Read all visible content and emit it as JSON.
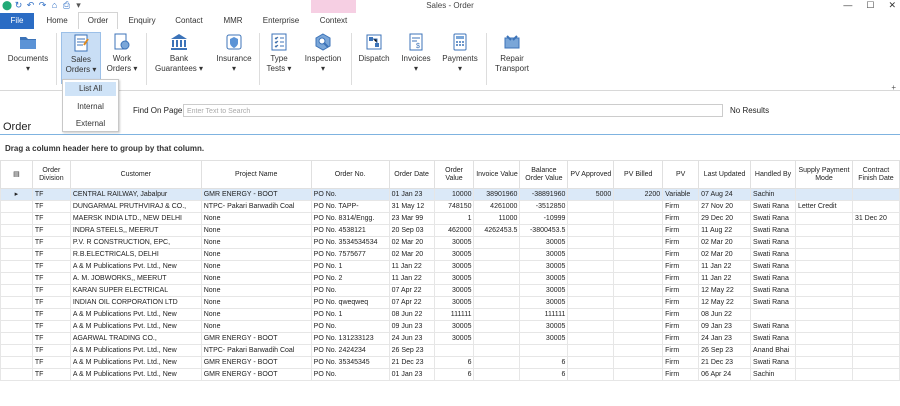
{
  "window": {
    "title": "Sales - Order"
  },
  "tabs": [
    {
      "label": "File"
    },
    {
      "label": "Home"
    },
    {
      "label": "Order"
    },
    {
      "label": "Enquiry"
    },
    {
      "label": "Contact"
    },
    {
      "label": "MMR"
    },
    {
      "label": "Enterprise"
    },
    {
      "label": "Context"
    }
  ],
  "ribbon": {
    "documents": "Documents",
    "sales_orders_1": "Sales",
    "sales_orders_2": "Orders ▾",
    "work_orders_1": "Work",
    "work_orders_2": "Orders ▾",
    "bank_1": "Bank",
    "bank_2": "Guarantees ▾",
    "insurance_1": "Insurance",
    "insurance_2": "▾",
    "type_tests_1": "Type",
    "type_tests_2": "Tests ▾",
    "inspection_1": "Inspection",
    "inspection_2": "▾",
    "dispatch": "Dispatch",
    "invoices_1": "Invoices",
    "invoices_2": "▾",
    "payments_1": "Payments",
    "payments_2": "▾",
    "repair_1": "Repair",
    "repair_2": "Transport"
  },
  "dropdown": {
    "items": [
      "List All",
      "Internal",
      "External"
    ]
  },
  "find": {
    "label": "Find On Page",
    "placeholder": "Enter Text to Search",
    "result": "No Results"
  },
  "section_title": "Order",
  "group_hint": "Drag a column header here to group by that column.",
  "grid": {
    "headers": [
      "Order Division",
      "Customer",
      "Project Name",
      "Order No.",
      "Order Date",
      "Order Value",
      "Invoice Value",
      "Balance Order Value",
      "PV Approved",
      "PV Billed",
      "PV",
      "Last Updated",
      "Handled By",
      "Supply Payment Mode",
      "Contract Finish Date"
    ],
    "rows": [
      [
        "TF",
        "CENTRAL RAILWAY, Jabalpur",
        "GMR ENERGY - BOOT",
        "PO No.",
        "01 Jan 23",
        "10000",
        "38901960",
        "-38891960",
        "5000",
        "2200",
        "Variable",
        "07 Aug 24",
        "Sachin",
        "",
        ""
      ],
      [
        "TF",
        "DUNGARMAL PRUTHVIRAJ & CO.,",
        "NTPC- Pakari Barwadih Coal",
        "PO No. TAPP-",
        "31 May 12",
        "748150",
        "4261000",
        "-3512850",
        "",
        "",
        "Firm",
        "27 Nov 20",
        "Swati Rana",
        "Letter Credit",
        ""
      ],
      [
        "TF",
        "MAERSK INDIA LTD., NEW DELHI",
        "None",
        "PO No. 8314/Engg.",
        "23 Mar 99",
        "1",
        "11000",
        "-10999",
        "",
        "",
        "Firm",
        "29 Dec 20",
        "Swati Rana",
        "",
        "31 Dec 20"
      ],
      [
        "TF",
        "INDRA STEELS,, MEERUT",
        "None",
        "PO No. 4538121",
        "20 Sep 03",
        "462000",
        "4262453.5",
        "-3800453.5",
        "",
        "",
        "Firm",
        "11 Aug 22",
        "Swati Rana",
        "",
        ""
      ],
      [
        "TF",
        "P.V. R CONSTRUCTION, EPC,",
        "None",
        "PO No. 3534534534",
        "02 Mar 20",
        "30005",
        "",
        "30005",
        "",
        "",
        "Firm",
        "02 Mar 20",
        "Swati Rana",
        "",
        ""
      ],
      [
        "TF",
        "R.B.ELECTRICALS, DELHI",
        "None",
        "PO No. 7575677",
        "02 Mar 20",
        "30005",
        "",
        "30005",
        "",
        "",
        "Firm",
        "02 Mar 20",
        "Swati Rana",
        "",
        ""
      ],
      [
        "TF",
        "A & M Publications Pvt. Ltd., New",
        "None",
        "PO No. 1",
        "11 Jan 22",
        "30005",
        "",
        "30005",
        "",
        "",
        "Firm",
        "11 Jan 22",
        "Swati Rana",
        "",
        ""
      ],
      [
        "TF",
        "A. M. JOBWORKS,, MEERUT",
        "None",
        "PO No. 2",
        "11 Jan 22",
        "30005",
        "",
        "30005",
        "",
        "",
        "Firm",
        "11 Jan 22",
        "Swati Rana",
        "",
        ""
      ],
      [
        "TF",
        "KARAN SUPER ELECTRICAL",
        "None",
        "PO No.",
        "07 Apr 22",
        "30005",
        "",
        "30005",
        "",
        "",
        "Firm",
        "12 May 22",
        "Swati Rana",
        "",
        ""
      ],
      [
        "TF",
        "INDIAN OIL CORPORATION LTD",
        "None",
        "PO No. qweqweq",
        "07 Apr 22",
        "30005",
        "",
        "30005",
        "",
        "",
        "Firm",
        "12 May 22",
        "Swati Rana",
        "",
        ""
      ],
      [
        "TF",
        "A & M Publications Pvt. Ltd., New",
        "None",
        "PO No. 1",
        "08 Jun 22",
        "111111",
        "",
        "111111",
        "",
        "",
        "Firm",
        "08 Jun 22",
        "",
        "",
        ""
      ],
      [
        "TF",
        "A & M Publications Pvt. Ltd., New",
        "None",
        "PO No.",
        "09 Jun 23",
        "30005",
        "",
        "30005",
        "",
        "",
        "Firm",
        "09 Jan 23",
        "Swati Rana",
        "",
        ""
      ],
      [
        "TF",
        "AGARWAL TRADING CO.,",
        "GMR ENERGY - BOOT",
        "PO No. 131233123",
        "24 Jun 23",
        "30005",
        "",
        "30005",
        "",
        "",
        "Firm",
        "24 Jan 23",
        "Swati Rana",
        "",
        ""
      ],
      [
        "TF",
        "A & M Publications Pvt. Ltd., New",
        "NTPC- Pakari Barwadih Coal",
        "PO No. 2424234",
        "26 Sep 23",
        "",
        "",
        "",
        "",
        "",
        "Firm",
        "26 Sep 23",
        "Anand Bhai",
        "",
        ""
      ],
      [
        "TF",
        "A & M Publications Pvt. Ltd., New",
        "GMR ENERGY - BOOT",
        "PO No. 35345345",
        "21 Dec 23",
        "6",
        "",
        "6",
        "",
        "",
        "Firm",
        "21 Dec 23",
        "Swati Rana",
        "",
        ""
      ],
      [
        "TF",
        "A & M Publications Pvt. Ltd., New",
        "GMR ENERGY - BOOT",
        "PO No.",
        "01 Jan 23",
        "6",
        "",
        "6",
        "",
        "",
        "Firm",
        "06 Apr 24",
        "Sachin",
        "",
        ""
      ]
    ]
  }
}
